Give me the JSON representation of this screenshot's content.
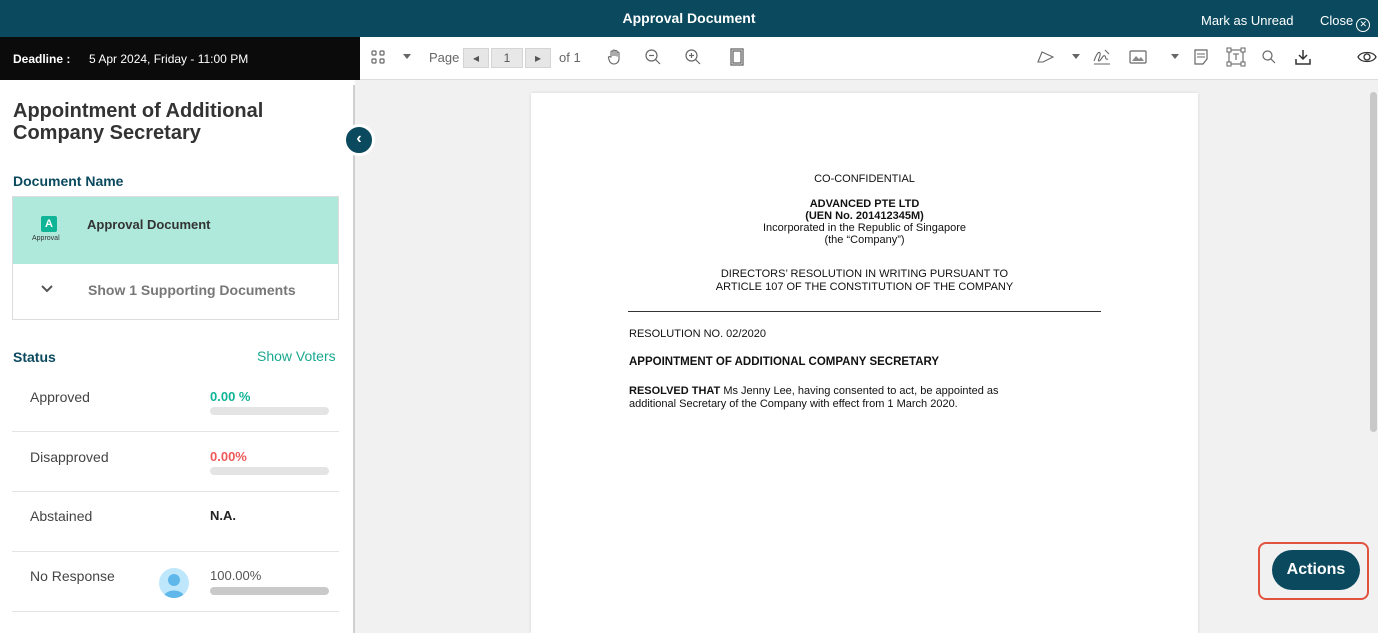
{
  "topbar": {
    "title": "Approval Document",
    "mark_unread": "Mark as Unread",
    "close": "Close"
  },
  "deadline": {
    "label": "Deadline :",
    "value": "5 Apr 2024, Friday - 11:00 PM"
  },
  "toolbar": {
    "page_label": "Page",
    "current_page": "1",
    "of_label": "of 1",
    "icons": [
      "thumbnails-icon",
      "dropdown-caret-icon",
      "prev-page-icon",
      "next-page-icon",
      "pan-hand-icon",
      "zoom-out-icon",
      "zoom-in-icon",
      "fit-page-icon",
      "draw-icon",
      "signature-icon",
      "image-icon",
      "note-icon",
      "text-field-icon",
      "search-icon",
      "download-icon",
      "view-icon"
    ]
  },
  "sidebar": {
    "heading": "Appointment of Additional Company Secretary",
    "document_name_label": "Document Name",
    "document": {
      "badge_letter": "A",
      "badge_label": "Approval",
      "name": "Approval Document"
    },
    "supporting_label": "Show 1 Supporting Documents",
    "status_label": "Status",
    "show_voters": "Show Voters",
    "statuses": [
      {
        "name": "Approved",
        "value": "0.00 %",
        "color": "#10b597",
        "fill": 0
      },
      {
        "name": "Disapproved",
        "value": "0.00%",
        "color": "#f05a5a",
        "fill": 0
      },
      {
        "name": "Abstained",
        "value": "N.A.",
        "color": "#222222"
      },
      {
        "name": "No Response",
        "value": "100.00%",
        "color": "#555555",
        "fill": 1
      }
    ]
  },
  "document_page": {
    "confidential": "CO-CONFIDENTIAL",
    "company": "ADVANCED PTE LTD",
    "uen": "(UEN No. 201412345M)",
    "incorporated": "Incorporated in the Republic of Singapore",
    "the_company": "(the “Company”)",
    "resolution_title_1": "DIRECTORS’ RESOLUTION IN WRITING PURSUANT TO",
    "resolution_title_2": "ARTICLE 107 OF THE CONSTITUTION OF THE COMPANY",
    "resolution_no": "RESOLUTION NO. 02/2020",
    "appointment_heading": "APPOINTMENT OF ADDITIONAL COMPANY SECRETARY",
    "resolved_bold": "RESOLVED THAT",
    "resolved_text_1": " Ms Jenny Lee, having consented to act, be appointed as",
    "resolved_text_2": "additional Secretary of the Company with effect from 1 March 2020."
  },
  "actions_label": "Actions",
  "colors": {
    "brand": "#0b4a5e",
    "accent": "#10b597",
    "highlight": "#aee9dc",
    "outline": "#e0533f"
  }
}
